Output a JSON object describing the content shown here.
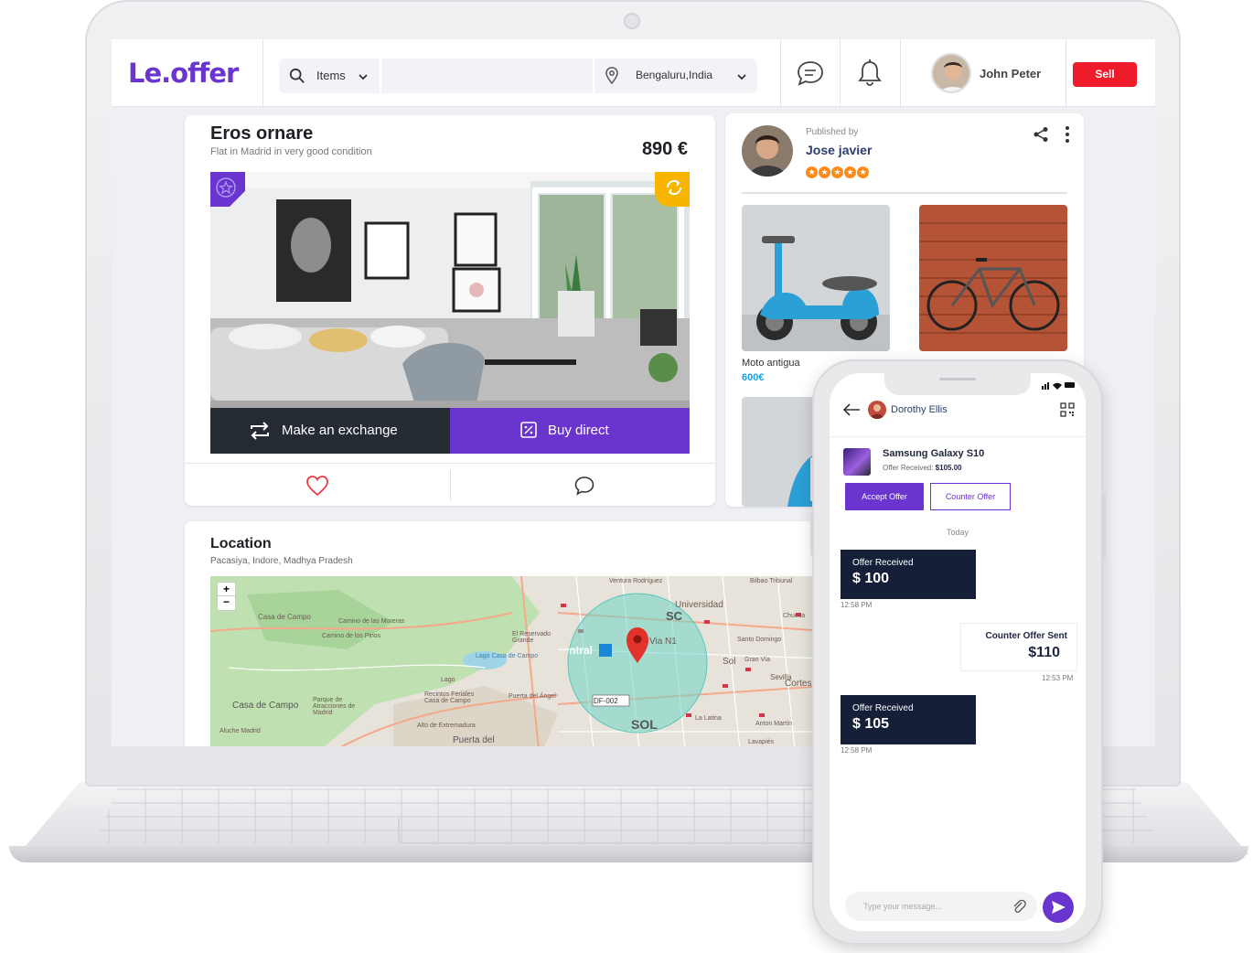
{
  "brand": {
    "logo": "Le.offer",
    "accent": "#6a34cf",
    "danger": "#ee1c2a"
  },
  "topnav": {
    "category": "Items",
    "location": "Bengaluru,India",
    "user_name": "John Peter",
    "sell_label": "Sell",
    "icons": [
      "search-icon",
      "chevron-down-icon",
      "map-pin-icon",
      "chat-icon",
      "bell-icon"
    ]
  },
  "listing": {
    "title": "Eros ornare",
    "subtitle": "Flat in Madrid in very good condition",
    "price": "890 €",
    "exchange_label": "Make an exchange",
    "buy_label": "Buy direct"
  },
  "seller": {
    "published_by": "Published by",
    "name": "Jose javier",
    "rating": 5,
    "products": [
      {
        "name": "Moto antigua",
        "price": "600€"
      },
      {
        "name": "",
        "price": ""
      }
    ]
  },
  "location": {
    "title": "Location",
    "address": "Pacasiya, Indore, Madhya Pradesh",
    "map_labels": [
      "Universidad",
      "Sol",
      "Casa de Campo",
      "Puerta del",
      "DF-002",
      "Sevilla",
      "Ventura Rodríguez",
      "Bilbao Tribunal",
      "Chueca",
      "Lago",
      "Anton Martín",
      "Lavapiés",
      "La Latina",
      "Recintos Feriales Casa de Campo",
      "Puerta del Ángel",
      "Gran Vía",
      "Santo Domingo",
      "Casa de Campo",
      "Camino de los Pinos",
      "Alto de Extremadura",
      "Lago Casa de Campo",
      "Parque de Atracciones de Madrid",
      "El Reservado Grande",
      "Aluche Madrid",
      "Camino de las Moreras",
      "SOL",
      "Cortes",
      "Via N1",
      "ntral",
      "SC"
    ]
  },
  "chat": {
    "contact_name": "Dorothy Ellis",
    "product_title": "Samsung Galaxy S10",
    "offer_received_label": "Offer Received:",
    "offer_received_value": "$105.00",
    "accept_label": "Accept Offer",
    "counter_label": "Counter Offer",
    "day_label": "Today",
    "messages": [
      {
        "label": "Offer Received",
        "amount": "$ 100",
        "time": "12:58 PM"
      },
      {
        "label": "Counter Offer Sent",
        "amount": "$110",
        "time": "12:53 PM"
      },
      {
        "label": "Offer Received",
        "amount": "$ 105",
        "time": "12:58 PM"
      }
    ],
    "input_placeholder": "Type your message..."
  }
}
